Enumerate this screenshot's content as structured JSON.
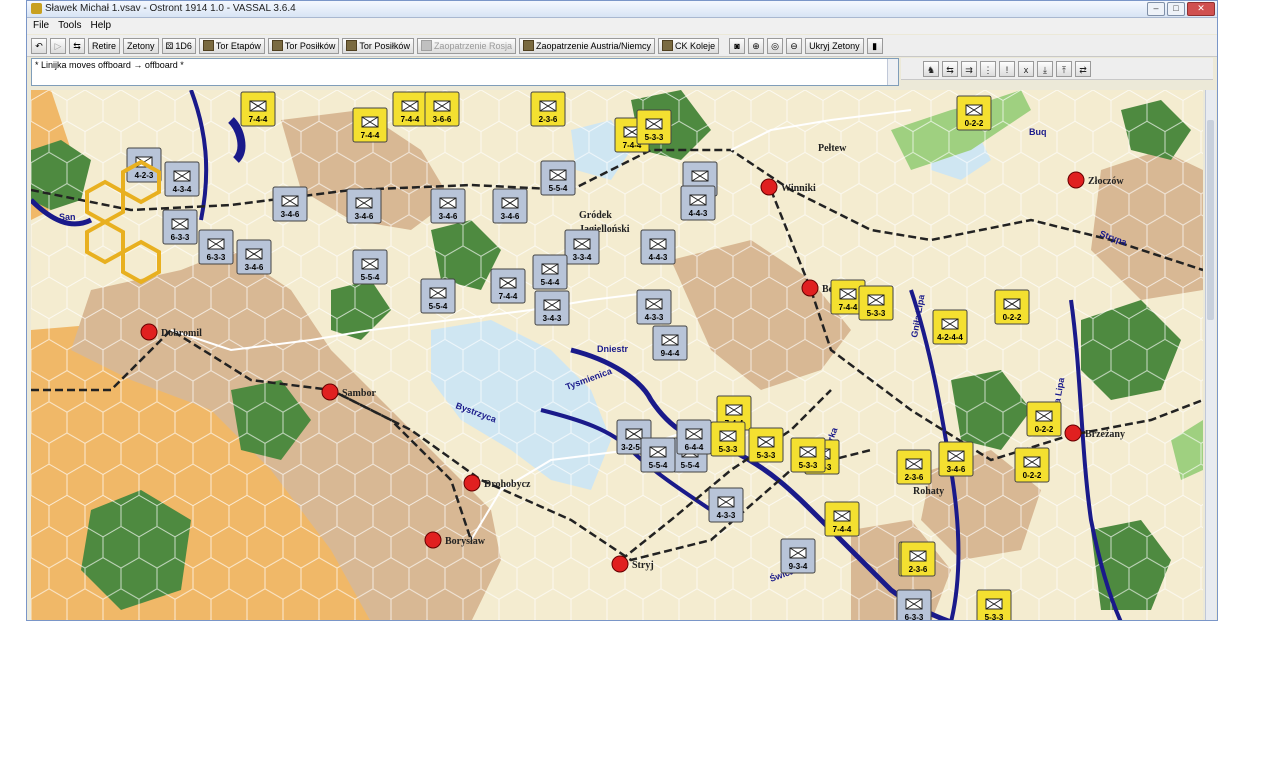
{
  "window": {
    "title": "Sławek Michał 1.vsav - Ostront 1914 1.0 - VASSAL 3.6.4",
    "controls": [
      "–",
      "□",
      "✕"
    ]
  },
  "menu": {
    "items": [
      "File",
      "Tools",
      "Help"
    ]
  },
  "toolbar": {
    "retire_label": "Retire",
    "zetony_label": "Zetony",
    "d6_label": "1D6",
    "tor_etapow_label": "Tor Etapów",
    "tor_posilkow1_label": "Tor Posiłków",
    "tor_posilkow2_label": "Tor Posiłków",
    "zaopatrzenie_rosja_label": "Zaopatrzenie Rosja",
    "zaopatrzenie_austria_label": "Zaopatrzenie Austria/Niemcy",
    "ck_koleje_label": "CK Koleje",
    "ukryj_zetony_label": "Ukryj Zetony"
  },
  "chat": {
    "line": "* Linijka moves offboard → offboard *"
  },
  "side_toolbar": {
    "buttons": [
      "!",
      "x"
    ]
  },
  "map": {
    "colors": {
      "plain": "#f4ecd0",
      "hills": "#d8b894",
      "mountains": "#f0b868",
      "forest": "#4e8a40",
      "marsh": "#cfe6f2",
      "river": "#1a1a8a",
      "city": "#e02020"
    },
    "towns": [
      {
        "name": "Dobromil"
      },
      {
        "name": "Sambor"
      },
      {
        "name": "Drohobycz"
      },
      {
        "name": "Borysław"
      },
      {
        "name": "Stryj"
      },
      {
        "name": "Winniki"
      },
      {
        "name": "Bóbrka"
      },
      {
        "name": "Złoczów"
      },
      {
        "name": "Brzeżany"
      },
      {
        "name": "Rohaty"
      },
      {
        "name": "Gródek"
      },
      {
        "name": "Jagielloński"
      },
      {
        "name": "Pełtew"
      }
    ],
    "rivers": [
      {
        "name": "San"
      },
      {
        "name": "Dniestr"
      },
      {
        "name": "Tysmienica"
      },
      {
        "name": "Bystrzyca"
      },
      {
        "name": "Gniła Lipa"
      },
      {
        "name": "Złota Lipa"
      },
      {
        "name": "Strypa"
      },
      {
        "name": "Buq"
      },
      {
        "name": "Świca"
      },
      {
        "name": "Bobrka"
      }
    ],
    "units": [
      {
        "id": "ak1",
        "label": "4-2-3",
        "side": "Austria"
      },
      {
        "id": "ak2",
        "label": "4-3-4",
        "side": "Austria"
      },
      {
        "id": "ak3",
        "label": "6-3-3",
        "side": "Austria"
      },
      {
        "id": "ak4",
        "label": "3-4-6",
        "side": "Austria"
      },
      {
        "id": "ak5",
        "label": "6-3-3",
        "side": "Austria"
      },
      {
        "id": "ak6",
        "label": "3-4-6",
        "side": "Austria"
      },
      {
        "id": "ak7",
        "label": "3-4-6",
        "side": "Austria"
      },
      {
        "id": "ak8",
        "label": "3-4-6",
        "side": "Austria"
      },
      {
        "id": "ak9",
        "label": "3-4-6",
        "side": "Austria"
      },
      {
        "id": "ak10",
        "label": "5-5-4",
        "side": "Austria"
      },
      {
        "id": "ak11",
        "label": "5-5-4",
        "side": "Austria"
      },
      {
        "id": "ak12",
        "label": "5-5-4",
        "side": "Austria"
      },
      {
        "id": "ak13",
        "label": "3-3-4",
        "side": "Austria"
      },
      {
        "id": "ak14",
        "label": "4-4-3",
        "side": "Austria"
      },
      {
        "id": "ak15",
        "label": "4-4-3",
        "side": "Austria"
      },
      {
        "id": "ak16",
        "label": "4-3-3",
        "side": "Austria"
      },
      {
        "id": "ak17",
        "label": "9-4-4",
        "side": "Austria"
      },
      {
        "id": "ak18",
        "label": "5-4-4",
        "side": "Austria"
      },
      {
        "id": "ak19",
        "label": "3-4-3",
        "side": "Austria"
      },
      {
        "id": "ak20",
        "label": "7-4-4",
        "side": "Austria"
      },
      {
        "id": "ak21",
        "label": "5-5-4",
        "side": "Austria"
      },
      {
        "id": "ak22",
        "label": "3-2-5-4",
        "side": "Austria"
      },
      {
        "id": "ak23",
        "label": "6-4-4",
        "side": "Austria"
      },
      {
        "id": "ak24",
        "label": "4-3-3",
        "side": "Austria"
      },
      {
        "id": "ak25",
        "label": "9-3-4",
        "side": "Austria"
      },
      {
        "id": "ak26",
        "label": "6-3-3",
        "side": "Austria"
      },
      {
        "id": "ak27",
        "label": "4-4-3",
        "side": "Austria"
      },
      {
        "id": "ak28",
        "label": "5-5-4",
        "side": "Austria"
      },
      {
        "id": "ru1",
        "label": "7-4-4",
        "side": "Russia"
      },
      {
        "id": "ru2",
        "label": "7-4-4",
        "side": "Russia"
      },
      {
        "id": "ru3",
        "label": "7-4-4",
        "side": "Russia"
      },
      {
        "id": "ru4",
        "label": "3-6-6",
        "side": "Russia"
      },
      {
        "id": "ru5",
        "label": "2-3-6",
        "side": "Russia"
      },
      {
        "id": "ru6",
        "label": "5-3-3",
        "side": "Russia"
      },
      {
        "id": "ru7",
        "label": "7-4-4",
        "side": "Russia"
      },
      {
        "id": "ru8",
        "label": "7-4-4",
        "side": "Russia"
      },
      {
        "id": "ru9",
        "label": "7-4-4",
        "side": "Russia"
      },
      {
        "id": "ru10",
        "label": "7-4-4",
        "side": "Russia"
      },
      {
        "id": "ru11",
        "label": "5-3-3",
        "side": "Russia"
      },
      {
        "id": "ru12",
        "label": "5-3-3",
        "side": "Russia"
      },
      {
        "id": "ru13",
        "label": "5-3-3",
        "side": "Russia"
      },
      {
        "id": "ru14",
        "label": "5-3-3",
        "side": "Russia"
      },
      {
        "id": "ru15",
        "label": "5-3-3",
        "side": "Russia"
      },
      {
        "id": "ru16",
        "label": "5-3-3",
        "side": "Russia"
      },
      {
        "id": "ru17",
        "label": "2-3-6",
        "side": "Russia"
      },
      {
        "id": "ru18",
        "label": "3-4-6",
        "side": "Russia"
      },
      {
        "id": "ru19",
        "label": "0-2-2",
        "side": "Russia"
      },
      {
        "id": "ru20",
        "label": "0-2-2",
        "side": "Russia"
      },
      {
        "id": "ru21",
        "label": "0-2-2",
        "side": "Russia"
      },
      {
        "id": "ru22",
        "label": "0-2-2",
        "side": "Russia"
      },
      {
        "id": "ru23",
        "label": "4-2-4-4",
        "side": "Russia"
      },
      {
        "id": "ru24",
        "label": "2-3-6",
        "side": "Russia"
      },
      {
        "id": "ru25",
        "label": "5-3-3",
        "side": "Russia"
      },
      {
        "id": "ru26",
        "label": "7-4-4",
        "side": "Russia"
      }
    ]
  }
}
